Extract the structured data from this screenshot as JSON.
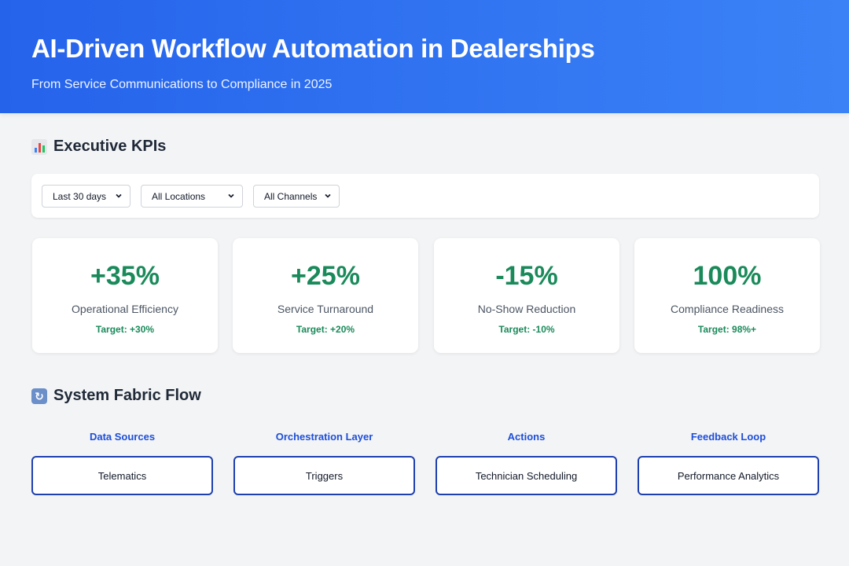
{
  "header": {
    "title": "AI-Driven Workflow Automation in Dealerships",
    "subtitle": "From Service Communications to Compliance in 2025"
  },
  "kpis_section": {
    "icon": "bar-chart-icon",
    "title": "Executive KPIs"
  },
  "filters": {
    "period": "Last 30 days",
    "location": "All Locations",
    "channel": "All Channels"
  },
  "kpis": [
    {
      "value": "+35%",
      "label": "Operational Efficiency",
      "target": "Target: +30%"
    },
    {
      "value": "+25%",
      "label": "Service Turnaround",
      "target": "Target: +20%"
    },
    {
      "value": "-15%",
      "label": "No-Show Reduction",
      "target": "Target: -10%"
    },
    {
      "value": "100%",
      "label": "Compliance Readiness",
      "target": "Target: 98%+"
    }
  ],
  "flow_section": {
    "icon": "cycle-arrows-icon",
    "title": "System Fabric Flow"
  },
  "flow": [
    {
      "heading": "Data Sources",
      "item": "Telematics"
    },
    {
      "heading": "Orchestration Layer",
      "item": "Triggers"
    },
    {
      "heading": "Actions",
      "item": "Technician Scheduling"
    },
    {
      "heading": "Feedback Loop",
      "item": "Performance Analytics"
    }
  ],
  "colors": {
    "header_gradient_start": "#2563eb",
    "header_gradient_end": "#3b82f6",
    "kpi_green": "#1a8a5a",
    "flow_blue": "#1d4ed8",
    "background": "#f3f4f6"
  }
}
